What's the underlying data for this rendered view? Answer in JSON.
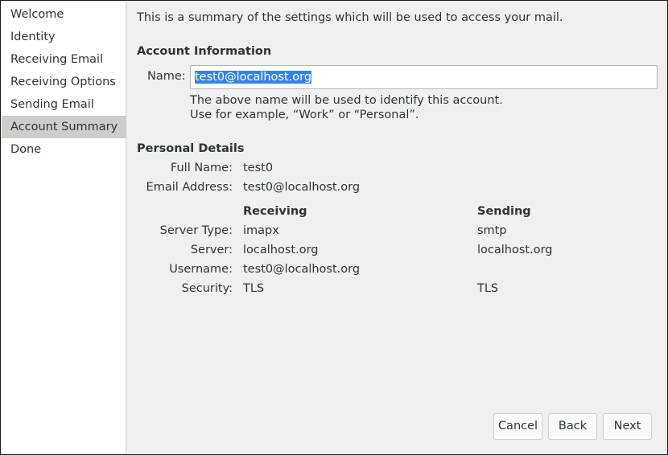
{
  "sidebar": {
    "items": [
      {
        "label": "Welcome"
      },
      {
        "label": "Identity"
      },
      {
        "label": "Receiving Email"
      },
      {
        "label": "Receiving Options"
      },
      {
        "label": "Sending Email"
      },
      {
        "label": "Account Summary",
        "selected": true
      },
      {
        "label": "Done"
      }
    ]
  },
  "intro": "This is a summary of the settings which will be used to access your mail.",
  "account_info": {
    "heading": "Account Information",
    "name_label": "Name:",
    "name_value": "test0@localhost.org",
    "hint_line1": "The above name will be used to identify this account.",
    "hint_line2": "Use for example, “Work” or “Personal”."
  },
  "personal": {
    "heading": "Personal Details",
    "full_name_label": "Full Name:",
    "full_name_value": "test0",
    "email_label": "Email Address:",
    "email_value": "test0@localhost.org"
  },
  "servers": {
    "receiving_header": "Receiving",
    "sending_header": "Sending",
    "server_type_label": "Server Type:",
    "server_label": "Server:",
    "username_label": "Username:",
    "security_label": "Security:",
    "receiving": {
      "server_type": "imapx",
      "server": "localhost.org",
      "username": "test0@localhost.org",
      "security": "TLS"
    },
    "sending": {
      "server_type": "smtp",
      "server": "localhost.org",
      "username": "",
      "security": "TLS"
    }
  },
  "buttons": {
    "cancel": "Cancel",
    "back": "Back",
    "next": "Next"
  }
}
